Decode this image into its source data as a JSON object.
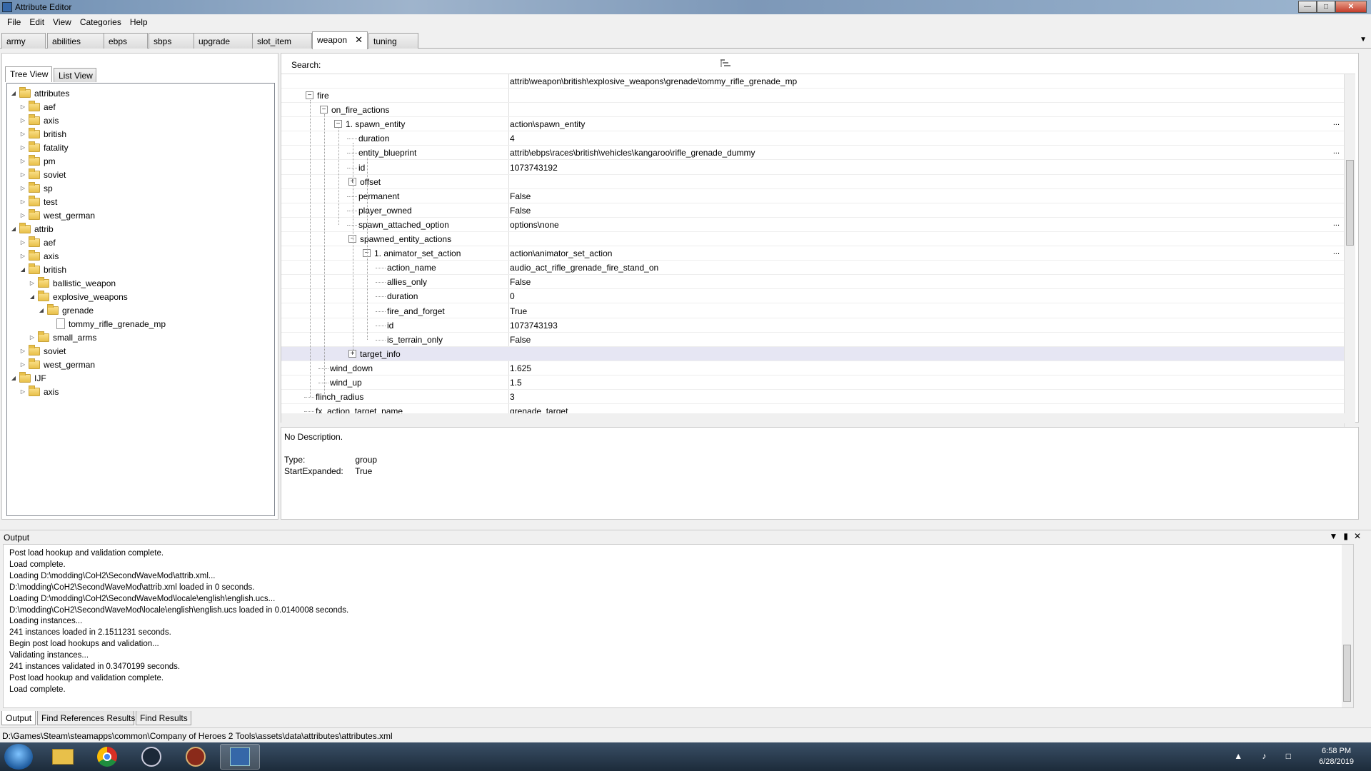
{
  "window": {
    "title": "Attribute Editor"
  },
  "menu": [
    "File",
    "Edit",
    "View",
    "Categories",
    "Help"
  ],
  "category_tabs": [
    "army",
    "abilities",
    "ebps",
    "sbps",
    "upgrade",
    "slot_item",
    "weapon",
    "tuning"
  ],
  "active_tab": "weapon",
  "left_tabs": [
    "Tree View",
    "List View"
  ],
  "tree": [
    {
      "label": "attributes",
      "level": 0,
      "expanded": true
    },
    {
      "label": "aef",
      "level": 1
    },
    {
      "label": "axis",
      "level": 1
    },
    {
      "label": "british",
      "level": 1
    },
    {
      "label": "fatality",
      "level": 1
    },
    {
      "label": "pm",
      "level": 1
    },
    {
      "label": "soviet",
      "level": 1
    },
    {
      "label": "sp",
      "level": 1
    },
    {
      "label": "test",
      "level": 1
    },
    {
      "label": "west_german",
      "level": 1
    },
    {
      "label": "attrib",
      "level": 0,
      "expanded": true
    },
    {
      "label": "aef",
      "level": 1
    },
    {
      "label": "axis",
      "level": 1
    },
    {
      "label": "british",
      "level": 1,
      "expanded": true
    },
    {
      "label": "ballistic_weapon",
      "level": 2
    },
    {
      "label": "explosive_weapons",
      "level": 2,
      "expanded": true
    },
    {
      "label": "grenade",
      "level": 3,
      "expanded": true
    },
    {
      "label": "tommy_rifle_grenade_mp",
      "level": 4,
      "file": true
    },
    {
      "label": "small_arms",
      "level": 2
    },
    {
      "label": "soviet",
      "level": 1
    },
    {
      "label": "west_german",
      "level": 1
    },
    {
      "label": "IJF",
      "level": 0,
      "expanded": true
    },
    {
      "label": "axis",
      "level": 1
    }
  ],
  "search": {
    "label": "Search:",
    "value": ""
  },
  "path_header": "attrib\\weapon\\british\\explosive_weapons\\grenade\\tommy_rifle_grenade_mp",
  "grid_rows": [
    {
      "name": "fire",
      "value": "",
      "level": 0,
      "exp": "-"
    },
    {
      "name": "on_fire_actions",
      "value": "",
      "level": 1,
      "exp": "-"
    },
    {
      "name": "1. spawn_entity",
      "value": "action\\spawn_entity",
      "level": 2,
      "exp": "-",
      "ellipsis": true
    },
    {
      "name": "duration",
      "value": "4",
      "level": 3
    },
    {
      "name": "entity_blueprint",
      "value": "attrib\\ebps\\races\\british\\vehicles\\kangaroo\\rifle_grenade_dummy",
      "level": 3,
      "ellipsis": true
    },
    {
      "name": "id",
      "value": "1073743192",
      "level": 3
    },
    {
      "name": "offset",
      "value": "",
      "level": 3,
      "exp": "+"
    },
    {
      "name": "permanent",
      "value": "False",
      "level": 3
    },
    {
      "name": "player_owned",
      "value": "False",
      "level": 3
    },
    {
      "name": "spawn_attached_option",
      "value": "options\\none",
      "level": 3,
      "ellipsis": true
    },
    {
      "name": "spawned_entity_actions",
      "value": "",
      "level": 3,
      "exp": "-"
    },
    {
      "name": "1. animator_set_action",
      "value": "action\\animator_set_action",
      "level": 4,
      "exp": "-",
      "ellipsis": true
    },
    {
      "name": "action_name",
      "value": "audio_act_rifle_grenade_fire_stand_on",
      "level": 5
    },
    {
      "name": "allies_only",
      "value": "False",
      "level": 5
    },
    {
      "name": "duration",
      "value": "0",
      "level": 5
    },
    {
      "name": "fire_and_forget",
      "value": "True",
      "level": 5
    },
    {
      "name": "id",
      "value": "1073743193",
      "level": 5
    },
    {
      "name": "is_terrain_only",
      "value": "False",
      "level": 5
    },
    {
      "name": "target_info",
      "value": "",
      "level": 3,
      "exp": "+",
      "selected": true
    },
    {
      "name": "wind_down",
      "value": "1.625",
      "level": 1
    },
    {
      "name": "wind_up",
      "value": "1.5",
      "level": 1
    },
    {
      "name": "flinch_radius",
      "value": "3",
      "level": 0
    },
    {
      "name": "fx_action_target_name",
      "value": "grenade_target",
      "level": 0
    }
  ],
  "description": {
    "text": "No Description.",
    "type_label": "Type:",
    "type_value": "group",
    "expanded_label": "StartExpanded:",
    "expanded_value": "True"
  },
  "output": {
    "title": "Output",
    "lines": [
      "Post load hookup and validation complete.",
      "Load complete.",
      "Loading D:\\modding\\CoH2\\SecondWaveMod\\attrib.xml...",
      "D:\\modding\\CoH2\\SecondWaveMod\\attrib.xml loaded in 0 seconds.",
      "Loading D:\\modding\\CoH2\\SecondWaveMod\\locale\\english\\english.ucs...",
      "D:\\modding\\CoH2\\SecondWaveMod\\locale\\english\\english.ucs loaded in 0.0140008 seconds.",
      "Loading instances...",
      "241 instances loaded in 2.1511231 seconds.",
      "Begin post load hookups and validation...",
      "Validating instances...",
      "241 instances validated in 0.3470199 seconds.",
      "Post load hookup and validation complete.",
      "Load complete."
    ]
  },
  "bottom_tabs": [
    "Output",
    "Find References Results",
    "Find Results"
  ],
  "status_path": "D:\\Games\\Steam\\steamapps\\common\\Company of Heroes 2 Tools\\assets\\data\\attributes\\attributes.xml",
  "clock": {
    "time": "6:58 PM",
    "date": "6/28/2019"
  }
}
